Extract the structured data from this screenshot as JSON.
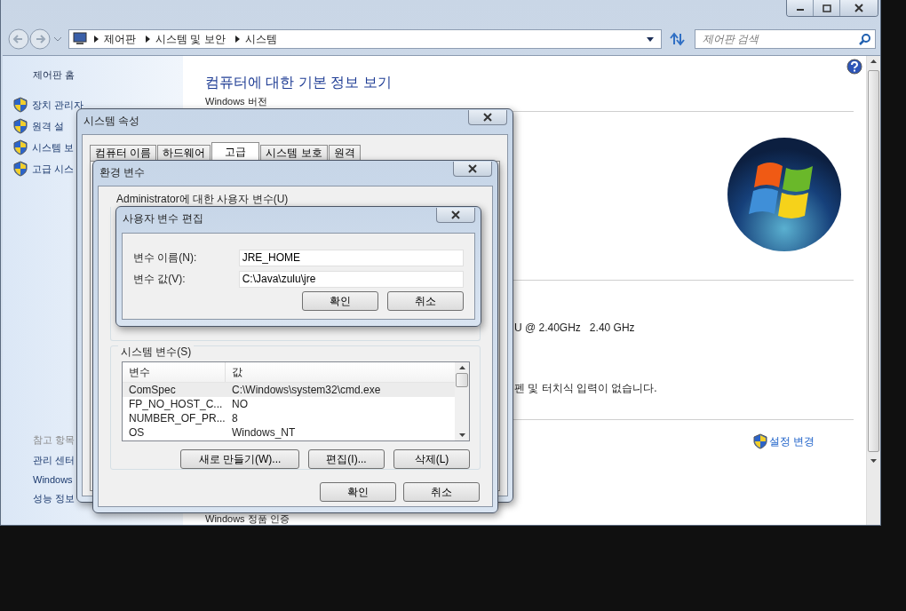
{
  "address_bar": {
    "breadcrumbs": [
      "제어판",
      "시스템 및 보안",
      "시스템"
    ],
    "search": {
      "placeholder": "제어판 검색"
    }
  },
  "sidebar": {
    "home": "제어판 홈",
    "tasks": [
      "장치 관리자",
      "원격 설",
      "시스템 보",
      "고급 시스"
    ],
    "see_also_heading": "참고 항목",
    "see_also": [
      "관리 센터",
      "Windows",
      "성능 정보"
    ]
  },
  "main": {
    "title": "컴퓨터에 대한 기본 정보 보기",
    "edition_heading": "Windows 버전",
    "processor": "U @ 2.40GHz   2.40 GHz",
    "pen_touch": "펜 및 터치식 입력이 없습니다.",
    "change_settings_link": "설정 변경",
    "activation_heading": "Windows 정품 인증"
  },
  "system_properties": {
    "title": "시스템 속성",
    "tabs": [
      {
        "label": "컴퓨터 이름",
        "selected": false
      },
      {
        "label": "하드웨어",
        "selected": false
      },
      {
        "label": "고급",
        "selected": true
      },
      {
        "label": "시스템 보호",
        "selected": false
      },
      {
        "label": "원격",
        "selected": false
      }
    ]
  },
  "environment_variables": {
    "title": "환경 변수",
    "user_group_label": "Administrator에 대한 사용자 변수(U)",
    "system_group_label": "시스템 변수(S)",
    "columns": [
      "변수",
      "값"
    ],
    "rows": [
      {
        "name": "ComSpec",
        "value": "C:\\Windows\\system32\\cmd.exe",
        "selected": true
      },
      {
        "name": "FP_NO_HOST_C...",
        "value": "NO",
        "selected": false
      },
      {
        "name": "NUMBER_OF_PR...",
        "value": "8",
        "selected": false
      },
      {
        "name": "OS",
        "value": "Windows_NT",
        "selected": false
      }
    ],
    "buttons": [
      "새로 만들기(W)...",
      "편집(I)...",
      "삭제(L)"
    ],
    "footer_buttons": [
      "확인",
      "취소"
    ]
  },
  "edit_user_variable": {
    "title": "사용자 변수 편집",
    "fields": [
      {
        "label": "변수 이름(N):",
        "value": "JRE_HOME"
      },
      {
        "label": "변수 값(V):",
        "value": "C:\\Java\\zulu\\jre"
      }
    ],
    "buttons": [
      "확인",
      "취소"
    ]
  }
}
